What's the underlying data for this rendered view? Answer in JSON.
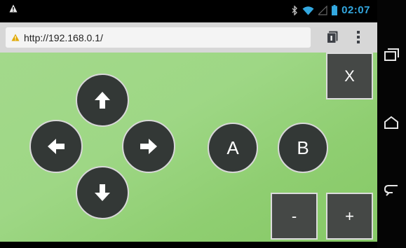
{
  "status_bar": {
    "time": "02:07",
    "icons": [
      "warning-icon",
      "bluetooth-icon",
      "wifi-icon",
      "signal-icon",
      "battery-icon"
    ],
    "accent_color": "#33a8e0"
  },
  "browser": {
    "url": "http://192.168.0.1/",
    "icons": [
      "warning-icon",
      "tabs-icon",
      "overflow-menu-icon"
    ]
  },
  "controller": {
    "dpad": [
      "arrow-up-icon",
      "arrow-left-icon",
      "arrow-right-icon",
      "arrow-down-icon"
    ],
    "button_a": "A",
    "button_b": "B",
    "button_x": "X",
    "button_minus": "-",
    "button_plus": "+",
    "background_color": "#9ed785",
    "button_color": "#333836"
  },
  "nav_bar": {
    "icons": [
      "recent-apps-icon",
      "home-icon",
      "back-icon"
    ]
  }
}
